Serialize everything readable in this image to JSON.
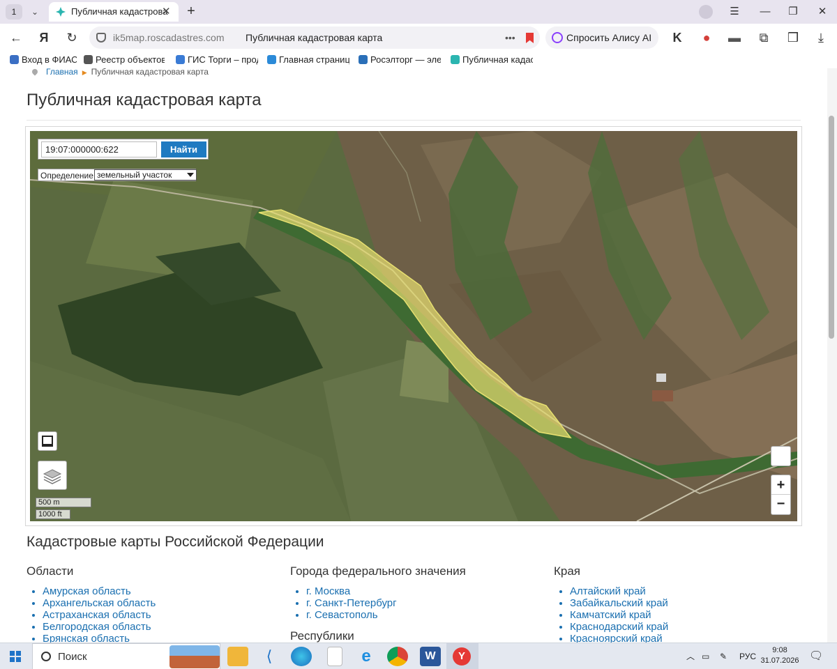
{
  "browser": {
    "tab_count": "1",
    "tab_title": "Публичная кадастрова",
    "url_site": "ik5map.roscadastres.com",
    "url_page_title": "Публичная кадастровая карта",
    "alice_button": "Спросить Алису AI",
    "bookmarks": [
      {
        "label": "Вход в ФИАС",
        "color": "#3b6fc4"
      },
      {
        "label": "Реестр объектов",
        "color": "#555555"
      },
      {
        "label": "ГИС Торги – прод",
        "color": "#3a7bd5"
      },
      {
        "label": "Главная страница",
        "color": "#2b8ad8"
      },
      {
        "label": "Росэлторг — элек",
        "color": "#2a6fb8"
      },
      {
        "label": "Публичная кадас",
        "color": "#2bb5b0"
      }
    ]
  },
  "breadcrumb": {
    "home": "Главная",
    "current": "Публичная кадастровая карта"
  },
  "page": {
    "title": "Публичная кадастровая карта"
  },
  "map": {
    "search_value": "19:07:000000:622",
    "search_button": "Найти",
    "definition_label": "Определение:",
    "definition_selected": "земельный участок",
    "zoom_in": "+",
    "zoom_out": "−",
    "scale_metric": "500 m",
    "scale_imperial": "1000 ft",
    "parcel_color": "#e8e070"
  },
  "regions": {
    "title": "Кадастровые карты Российской Федерации",
    "oblasti": {
      "heading": "Области",
      "items": [
        "Амурская область",
        "Архангельская область",
        "Астраханская область",
        "Белгородская область",
        "Брянская область"
      ]
    },
    "cities": {
      "heading": "Города федерального значения",
      "items": [
        "г. Москва",
        "г. Санкт-Петербург",
        "г. Севастополь"
      ]
    },
    "republics_heading": "Республики",
    "kraya": {
      "heading": "Края",
      "items": [
        "Алтайский край",
        "Забайкальский край",
        "Камчатский край",
        "Краснодарский край",
        "Красноярский край"
      ]
    }
  },
  "taskbar": {
    "search": "Поиск",
    "language": "РУС",
    "time": "9:08",
    "date": "31.07.2026"
  }
}
